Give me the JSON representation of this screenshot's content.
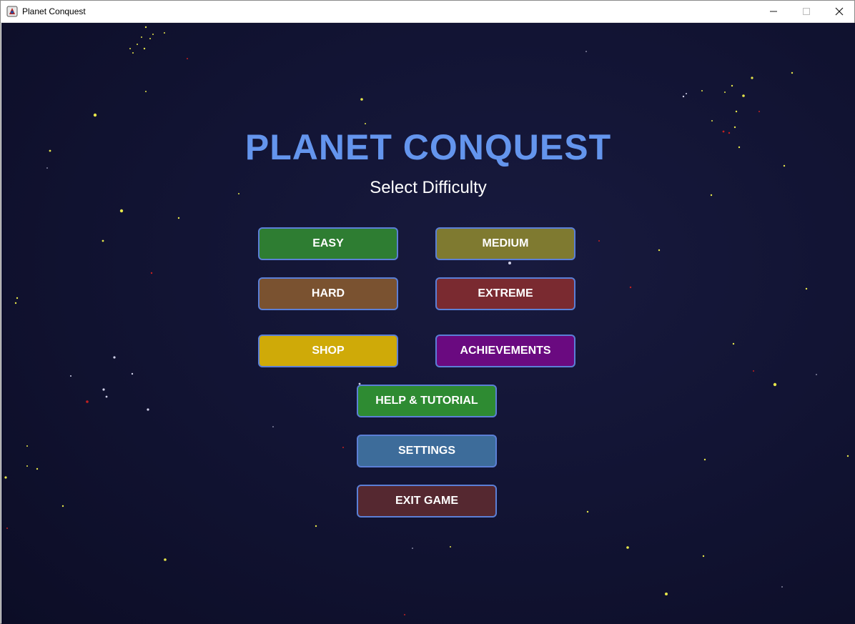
{
  "window": {
    "title": "Planet Conquest",
    "icon": "app-icon",
    "controls": [
      "minimize-icon",
      "maximize-icon",
      "close-icon"
    ]
  },
  "game": {
    "title": "PLANET CONQUEST",
    "subtitle": "Select Difficulty",
    "title_color": "#6495ed",
    "background_color": "#121434"
  },
  "buttons": {
    "easy": {
      "label": "EASY",
      "color": "#2e7d32"
    },
    "medium": {
      "label": "MEDIUM",
      "color": "#7f7a30"
    },
    "hard": {
      "label": "HARD",
      "color": "#7a5230"
    },
    "extreme": {
      "label": "EXTREME",
      "color": "#7a2a30"
    },
    "shop": {
      "label": "SHOP",
      "color": "#cfaa08"
    },
    "achievements": {
      "label": "ACHIEVEMENTS",
      "color": "#6a0a80"
    },
    "help": {
      "label": "HELP & TUTORIAL",
      "color": "#2e8b32"
    },
    "settings": {
      "label": "SETTINGS",
      "color": "#3d6c9a"
    },
    "exit": {
      "label": "EXIT GAME",
      "color": "#552830"
    },
    "border_color": "#5b7fd6"
  }
}
